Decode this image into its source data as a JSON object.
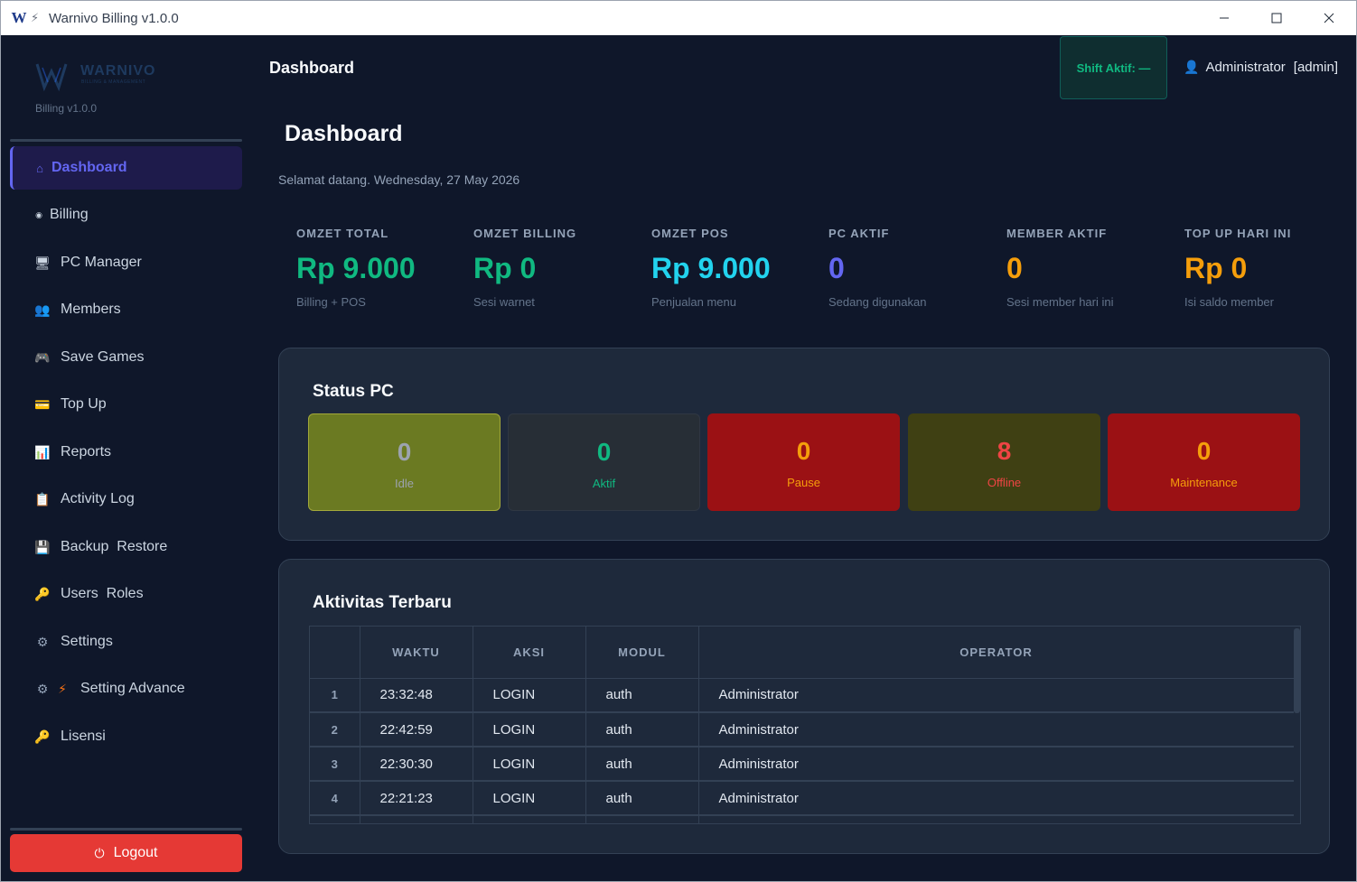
{
  "window": {
    "title": "Warnivo Billing v1.0.0",
    "logo": "W",
    "bolt": "⚡",
    "min": "—",
    "max": "☐",
    "close": "✕"
  },
  "sidebar": {
    "brand_name": "WARNIVO",
    "brand_tagline": "BILLING & MANAGEMENT",
    "version": "Billing v1.0.0",
    "items": [
      {
        "label": "Dashboard",
        "icon": "⌂",
        "icon_name": "home-icon"
      },
      {
        "label": "Billing",
        "icon": "◉",
        "icon_name": "billing-icon"
      },
      {
        "label": "PC Manager",
        "icon": "🖥",
        "icon_name": "monitor-icon"
      },
      {
        "label": "Members",
        "icon": "👥",
        "icon_name": "members-icon"
      },
      {
        "label": "Save Games",
        "icon": "🎮",
        "icon_name": "gamepad-icon"
      },
      {
        "label": "Top Up",
        "icon": "💳",
        "icon_name": "card-icon"
      },
      {
        "label": "Reports",
        "icon": "📊",
        "icon_name": "chart-icon"
      },
      {
        "label": "Activity Log",
        "icon": "📋",
        "icon_name": "clipboard-icon"
      },
      {
        "label": "Backup  Restore",
        "icon": "💾",
        "icon_name": "floppy-icon"
      },
      {
        "label": "Users  Roles",
        "icon": "🔑",
        "icon_name": "key-icon"
      },
      {
        "label": "Settings",
        "icon": "⚙",
        "icon_name": "gear-icon"
      },
      {
        "label": "Setting Advance",
        "icon": "⚙",
        "icon2": "⚡",
        "icon_name": "gear-bolt-icon"
      },
      {
        "label": "Lisensi",
        "icon": "🔑",
        "icon_name": "license-key-icon"
      }
    ],
    "logout_label": "Logout",
    "logout_icon": "⏻"
  },
  "header": {
    "title": "Dashboard",
    "shift_label": "Shift Aktif: —",
    "user_icon": "👤",
    "user_name": "Administrator",
    "user_role": "[admin]"
  },
  "main": {
    "title": "Dashboard",
    "welcome": "Selamat datang. Wednesday, 27 May 2026",
    "stats": [
      {
        "label": "OMZET TOTAL",
        "value": "Rp 9.000",
        "sub": "Billing + POS",
        "color": "#10b981"
      },
      {
        "label": "OMZET BILLING",
        "value": "Rp 0",
        "sub": "Sesi warnet",
        "color": "#10b981"
      },
      {
        "label": "OMZET POS",
        "value": "Rp 9.000",
        "sub": "Penjualan menu",
        "color": "#22d3ee"
      },
      {
        "label": "PC AKTIF",
        "value": "0",
        "sub": "Sedang digunakan",
        "color": "#6366f1"
      },
      {
        "label": "MEMBER AKTIF",
        "value": "0",
        "sub": "Sesi member hari ini",
        "color": "#f59e0b"
      },
      {
        "label": "TOP UP HARI INI",
        "value": "Rp 0",
        "sub": "Isi saldo member",
        "color": "#f59e0b"
      }
    ],
    "status_pc": {
      "title": "Status PC",
      "tiles": [
        {
          "count": "0",
          "label": "Idle",
          "bg": "#6b7a22",
          "border": "#a3a83a",
          "num_color": "#9ca3af",
          "label_color": "#9ca3af"
        },
        {
          "count": "0",
          "label": "Aktif",
          "bg": "#272e36",
          "border": "#2f3743",
          "num_color": "#10b981",
          "label_color": "#10b981"
        },
        {
          "count": "0",
          "label": "Pause",
          "bg": "#9b1114",
          "border": "#9b1114",
          "num_color": "#f59e0b",
          "label_color": "#f59e0b"
        },
        {
          "count": "8",
          "label": "Offline",
          "bg": "#3f4013",
          "border": "#3f4013",
          "num_color": "#ef4444",
          "label_color": "#ef4444"
        },
        {
          "count": "0",
          "label": "Maintenance",
          "bg": "#9b1114",
          "border": "#9b1114",
          "num_color": "#f59e0b",
          "label_color": "#f59e0b"
        }
      ]
    },
    "activity": {
      "title": "Aktivitas Terbaru",
      "columns": [
        "",
        "WAKTU",
        "AKSI",
        "MODUL",
        "OPERATOR"
      ],
      "rows": [
        {
          "no": "1",
          "waktu": "23:32:48",
          "aksi": "LOGIN",
          "modul": "auth",
          "operator": "Administrator"
        },
        {
          "no": "2",
          "waktu": "22:42:59",
          "aksi": "LOGIN",
          "modul": "auth",
          "operator": "Administrator"
        },
        {
          "no": "3",
          "waktu": "22:30:30",
          "aksi": "LOGIN",
          "modul": "auth",
          "operator": "Administrator"
        },
        {
          "no": "4",
          "waktu": "22:21:23",
          "aksi": "LOGIN",
          "modul": "auth",
          "operator": "Administrator"
        }
      ]
    }
  }
}
